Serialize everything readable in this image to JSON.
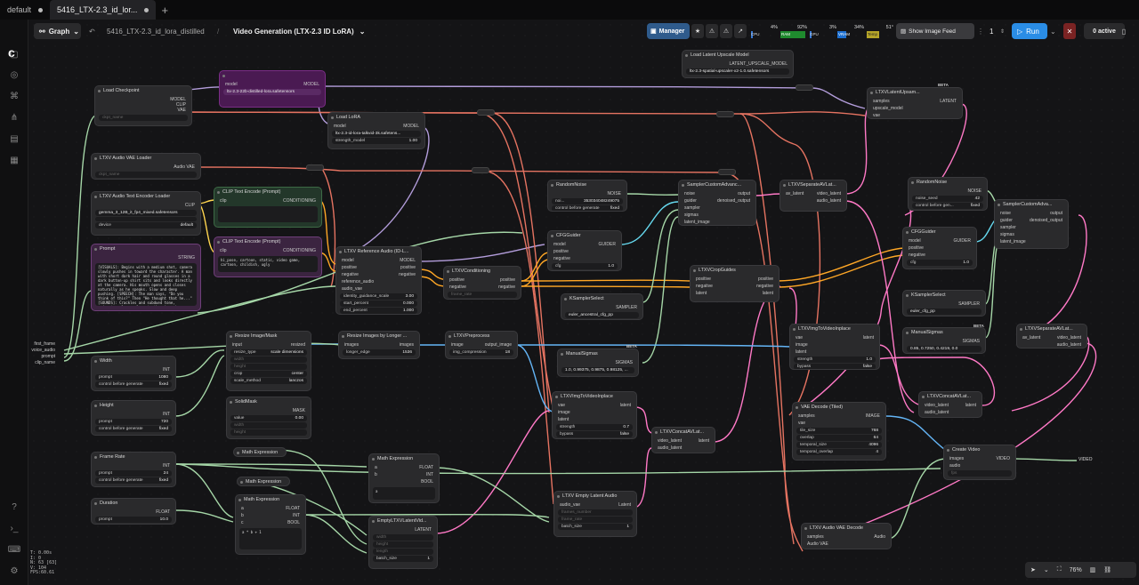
{
  "tabs": [
    {
      "label": "default"
    },
    {
      "label": "5416_LTX-2.3_id_lor..."
    }
  ],
  "tab_plus": "+",
  "topbar": {
    "graph_label": "Graph",
    "workflow_name": "5416_LTX-2.3_id_lora_distilled",
    "separator": "/",
    "subgraph_name": "Video Generation (LTX-2.3 ID LoRA)",
    "manager_label": "Manager",
    "stats": [
      {
        "label": "CPU",
        "value": "4%"
      },
      {
        "label": "RAM",
        "value": "92%"
      },
      {
        "label": "GPU",
        "value": "3%"
      },
      {
        "label": "VRAM",
        "value": "34%"
      },
      {
        "label": "Temp",
        "value": "51°"
      }
    ],
    "show_feed_label": "Show Image Feed",
    "queue_count": "1",
    "run_label": "Run",
    "active_label": "0 active"
  },
  "nodes": {
    "load_checkpoint": {
      "title": "Load Checkpoint",
      "outs": [
        "MODEL",
        "CLIP",
        "VAE"
      ],
      "widget": "ckpt_name"
    },
    "lora_loader_bypassed": {
      "in": "model",
      "out": "MODEL",
      "widget": "lora_name",
      "value": "ltx-2.3-22b-distilled-lora.safetensors"
    },
    "load_lora": {
      "title": "Load LoRA",
      "in": "model",
      "out": "MODEL",
      "lora": "ltx-2.3-id-lora-talkvid-3k.safetens...",
      "strength_label": "strength_model",
      "strength": "1.00"
    },
    "latent_upscale": {
      "title": "Load Latent Upscale Model",
      "out": "LATENT_UPSCALE_MODEL",
      "value": "ltx-2.3-spatial-upscaler-x2-1.0.safetensors"
    },
    "latent_upsampler": {
      "title": "LTXVLatentUpsam...",
      "ins": [
        "samples",
        "upscale_model",
        "vae"
      ],
      "out": "LATENT",
      "beta": "BETA"
    },
    "audio_vae_loader": {
      "title": "LTXV Audio VAE Loader",
      "out": "Audio VAE",
      "widget": "ckpt_name"
    },
    "audio_text_encoder": {
      "title": "LTXV Audio Text Encoder Loader",
      "out": "CLIP",
      "value": "gemma_3_12B_it_fp4_mixed.safetensors",
      "device_label": "device",
      "device": "default"
    },
    "clip_pos": {
      "title": "CLIP Text Encode (Prompt)",
      "in": "clip",
      "out": "CONDITIONING"
    },
    "clip_neg": {
      "title": "CLIP Text Encode (Prompt)",
      "in": "clip",
      "out": "CONDITIONING",
      "text": "hi_pose, cartoon, static, video game, cartoon, childish, ugly"
    },
    "prompt": {
      "title": "Prompt",
      "out": "STRING",
      "text": "[VISUALS]: Begins with a medium shot, camera slowly pushes in toward the character. A man with short dark hair and round glasses in a dark button-up shirt sits and looks directly at the camera. His mouth opens and closes naturally as he speaks. Slow and deep pushing. [SPEECH]: The man says, \"Do you think of this?\" Then \"He thought that he...\" [SOUNDS]: Crackles and subdued tone, moderate volume, close to the microphone."
    },
    "ref_audio": {
      "title": "LTXV Reference Audio (ID-L...",
      "ins": [
        "model",
        "positive",
        "negative",
        "reference_audio",
        "audio_vae"
      ],
      "outs": [
        "MODEL",
        "positive",
        "negative"
      ],
      "w": [
        [
          "identity_guidance_scale",
          "3.00"
        ],
        [
          "start_percent",
          "0.000"
        ],
        [
          "end_percent",
          "1.000"
        ]
      ]
    },
    "ltxv_cond": {
      "title": "LTXVConditioning",
      "ins": [
        "positive",
        "negative"
      ],
      "outs": [
        "positive",
        "negative"
      ],
      "w": "frame_rate"
    },
    "random_noise1": {
      "title": "RandomNoise",
      "out": "NOISE",
      "w": [
        [
          "noi...",
          "353034048249075"
        ],
        [
          "control before generate",
          "fixed"
        ]
      ]
    },
    "cfg_guider1": {
      "title": "CFGGuider",
      "ins": [
        "model",
        "positive",
        "negative"
      ],
      "out": "GUIDER",
      "w": [
        [
          "cfg",
          "1.0"
        ]
      ]
    },
    "ksampler_select1": {
      "title": "KSamplerSelect",
      "out": "SAMPLER",
      "value": "euler_ancestral_cfg_pp"
    },
    "sampler_custom1": {
      "title": "SamplerCustomAdvanc...",
      "ins": [
        "noise",
        "guider",
        "sampler",
        "sigmas",
        "latent_image"
      ],
      "outs": [
        "output",
        "denoised_output"
      ]
    },
    "crop_guides": {
      "title": "LTXVCropGuides",
      "ins": [
        "positive",
        "negative",
        "latent"
      ],
      "outs": [
        "positive",
        "negative",
        "latent"
      ]
    },
    "separate1": {
      "title": "LTXVSeparateAVLat...",
      "in": "av_latent",
      "outs": [
        "video_latent",
        "audio_latent"
      ]
    },
    "random_noise2": {
      "title": "RandomNoise",
      "out": "NOISE",
      "w": [
        [
          "noise_seed",
          "42"
        ],
        [
          "control before gen...",
          "fixed"
        ]
      ]
    },
    "cfg_guider2": {
      "title": "CFGGuider",
      "ins": [
        "model",
        "positive",
        "negative"
      ],
      "out": "GUIDER",
      "w": [
        [
          "cfg",
          "1.0"
        ]
      ]
    },
    "sampler_custom2": {
      "title": "SamplerCustomAdva...",
      "ins": [
        "noise",
        "guider",
        "sampler",
        "sigmas",
        "latent_image"
      ],
      "outs": [
        "output",
        "denoised_output"
      ]
    },
    "ksampler_select2": {
      "title": "KSamplerSelect",
      "out": "SAMPLER",
      "value": "euler_cfg_pp"
    },
    "manual_sigmas2": {
      "title": "ManualSigmas",
      "out": "SIGMAS",
      "value": "0.85, 0.7250, 0.4219, 0.0"
    },
    "separate2": {
      "title": "LTXVSeparateAVLat...",
      "in": "av_latent",
      "outs": [
        "video_latent",
        "audio_latent"
      ],
      "beta": "BETA"
    },
    "img_to_video2": {
      "title": "LTXVImgToVideoInplace",
      "ins": [
        "vae",
        "image",
        "latent"
      ],
      "out": "latent",
      "w": [
        [
          "strength",
          "1.0"
        ],
        [
          "bypass",
          "false"
        ]
      ]
    },
    "concat2": {
      "title": "LTXVConcatAVLat...",
      "ins": [
        "video_latent",
        "audio_latent"
      ],
      "out": "latent"
    },
    "vae_decode_tiled": {
      "title": "VAE Decode (Tiled)",
      "ins": [
        "samples",
        "vae"
      ],
      "out": "IMAGE",
      "w": [
        [
          "tile_size",
          "768"
        ],
        [
          "overlap",
          "64"
        ],
        [
          "temporal_size",
          "4096"
        ],
        [
          "temporal_overlap",
          "4"
        ]
      ]
    },
    "create_video": {
      "title": "Create Video",
      "ins": [
        "images",
        "audio",
        "fps"
      ],
      "out": "VIDEO"
    },
    "audio_vae_decode": {
      "title": "LTXV Audio VAE Decode",
      "ins": [
        "samples",
        "Audio VAE"
      ],
      "out": "Audio"
    },
    "resize_mask": {
      "title": "Resize Image/Mask",
      "in": "input",
      "out": "resized",
      "w": [
        [
          "resize_type",
          "scale dimensions"
        ],
        [
          "width",
          ""
        ],
        [
          "height",
          ""
        ],
        [
          "crop",
          "center"
        ],
        [
          "scale_method",
          "lanczos"
        ]
      ]
    },
    "resize_longer": {
      "title": "Resize Images by Longer ...",
      "in": "images",
      "out": "images",
      "w": [
        [
          "longer_edge",
          "1536"
        ]
      ]
    },
    "preprocess": {
      "title": "LTXVPreprocess",
      "in": "image",
      "out": "output_image",
      "w": [
        [
          "img_compression",
          "18"
        ]
      ]
    },
    "manual_sigmas1": {
      "title": "ManualSigmas",
      "out": "SIGMAS",
      "value": "1.0, 0.99375, 0.9875, 0.98125, ..."
    },
    "img_to_video1": {
      "title": "LTXVImgToVideoInplace",
      "ins": [
        "vae",
        "image",
        "latent"
      ],
      "out": "latent",
      "w": [
        [
          "strength",
          "0.7"
        ],
        [
          "bypass",
          "false"
        ]
      ]
    },
    "concat1": {
      "title": "LTXVConcatAVLat...",
      "ins": [
        "video_latent",
        "audio_latent"
      ],
      "out": "latent"
    },
    "empty_audio_latent": {
      "title": "LTXV Empty Latent Audio",
      "in": "audio_vae",
      "out": "Latent",
      "w": [
        [
          "frames_number",
          ""
        ],
        [
          "frame_rate",
          ""
        ],
        [
          "batch_size",
          "1"
        ]
      ]
    },
    "empty_video_latent": {
      "title": "EmptyLTXVLatentVid...",
      "out": "LATENT",
      "w": [
        [
          "width",
          ""
        ],
        [
          "height",
          ""
        ],
        [
          "length",
          ""
        ],
        [
          "batch_size",
          "1"
        ]
      ]
    },
    "width": {
      "title": "Width",
      "out": "INT",
      "w": [
        [
          "prompt",
          "1080"
        ],
        [
          "control before generate",
          "fixed"
        ]
      ]
    },
    "height": {
      "title": "Height",
      "out": "INT",
      "w": [
        [
          "prompt",
          "720"
        ],
        [
          "control before generate",
          "fixed"
        ]
      ]
    },
    "frame_rate": {
      "title": "Frame Rate",
      "out": "INT",
      "w": [
        [
          "prompt",
          "24"
        ],
        [
          "control before generate",
          "fixed"
        ]
      ]
    },
    "duration": {
      "title": "Duration",
      "out": "FLOAT",
      "w": [
        [
          "prompt",
          "10.0"
        ]
      ]
    },
    "solid_mask": {
      "title": "SolidMask",
      "out": "MASK",
      "w": [
        [
          "value",
          "0.00"
        ],
        [
          "width",
          ""
        ],
        [
          "height",
          ""
        ]
      ]
    },
    "math1": {
      "title": "Math Expression"
    },
    "math2": {
      "title": "Math Expression"
    },
    "math3": {
      "title": "Math Expression",
      "ins": [
        "a",
        "b",
        "c"
      ],
      "outs": [
        "FLOAT",
        "INT",
        "BOOL"
      ],
      "expr": "a * b + 1"
    },
    "math4": {
      "title": "Math Expression",
      "ins": [
        "a",
        "b"
      ],
      "outs": [
        "FLOAT",
        "INT",
        "BOOL"
      ],
      "expr": "a"
    }
  },
  "subgraph_inputs": [
    "first_frame",
    "voice_audio",
    "prompt",
    "clip_name"
  ],
  "subgraph_output": "VIDEO",
  "stats_overlay": [
    "T: 0.00s",
    "I: 0",
    "N: 63 [63]",
    "V: 104",
    "FPS:60.61"
  ],
  "zoom": "76%"
}
